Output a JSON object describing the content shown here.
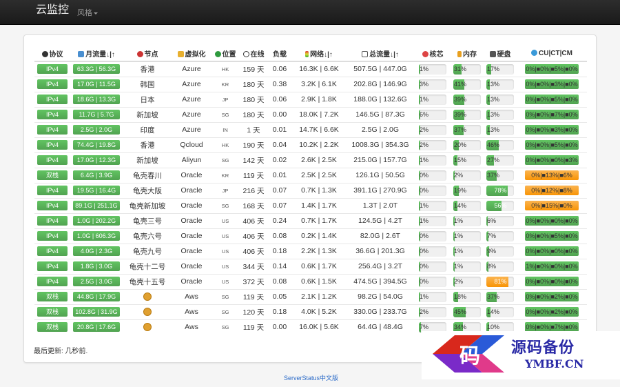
{
  "navbar": {
    "brand": "云监控",
    "style_menu": "风格"
  },
  "columns": {
    "protocol": "协议",
    "monthly_traffic": "月流量↓|↑",
    "node": "节点",
    "virtualization": "虚拟化",
    "location": "位置",
    "uptime": "在线",
    "load": "负载",
    "network": "网络↓|↑",
    "total_traffic": "总流量↓|↑",
    "cpu": "核芯",
    "memory": "内存",
    "disk": "硬盘",
    "cu_ct_cm": "CU|CT|CM"
  },
  "rows": [
    {
      "protocol": "IPv4",
      "monthly": "63.3G | 56.3G",
      "node": "香港",
      "node_lion": false,
      "virt": "Azure",
      "loc": "HK",
      "uptime": "159 天",
      "load": "0.06",
      "network": "16.3K | 6.6K",
      "total": "507.5G | 447.0G",
      "cpu": "1%",
      "cpu_level": 0.01,
      "mem": "31%",
      "mem_level": 0.31,
      "disk": "17%",
      "disk_level": 0.17,
      "disk_warn": false,
      "cuct": "0%|■0%|■5%|■0%",
      "cuct_warn": false
    },
    {
      "protocol": "IPv4",
      "monthly": "17.0G | 11.5G",
      "node": "韩国",
      "node_lion": false,
      "virt": "Azure",
      "loc": "KR",
      "uptime": "180 天",
      "load": "0.38",
      "network": "3.2K | 6.1K",
      "total": "202.8G | 146.9G",
      "cpu": "3%",
      "cpu_level": 0.03,
      "mem": "41%",
      "mem_level": 0.41,
      "disk": "13%",
      "disk_level": 0.13,
      "disk_warn": false,
      "cuct": "0%|■0%|■3%|■0%",
      "cuct_warn": false
    },
    {
      "protocol": "IPv4",
      "monthly": "18.6G | 13.3G",
      "node": "日本",
      "node_lion": false,
      "virt": "Azure",
      "loc": "JP",
      "uptime": "180 天",
      "load": "0.06",
      "network": "2.9K | 1.8K",
      "total": "188.0G | 132.6G",
      "cpu": "1%",
      "cpu_level": 0.01,
      "mem": "39%",
      "mem_level": 0.39,
      "disk": "13%",
      "disk_level": 0.13,
      "disk_warn": false,
      "cuct": "0%|■0%|■5%|■0%",
      "cuct_warn": false
    },
    {
      "protocol": "IPv4",
      "monthly": "11.7G | 5.7G",
      "node": "新加坡",
      "node_lion": false,
      "virt": "Azure",
      "loc": "SG",
      "uptime": "180 天",
      "load": "0.00",
      "network": "18.0K | 7.2K",
      "total": "146.5G | 87.3G",
      "cpu": "6%",
      "cpu_level": 0.06,
      "mem": "39%",
      "mem_level": 0.39,
      "disk": "13%",
      "disk_level": 0.13,
      "disk_warn": false,
      "cuct": "0%|■0%|■7%|■0%",
      "cuct_warn": false
    },
    {
      "protocol": "IPv4",
      "monthly": "2.5G | 2.0G",
      "node": "印度",
      "node_lion": false,
      "virt": "Azure",
      "loc": "IN",
      "uptime": "1 天",
      "load": "0.01",
      "network": "14.7K | 6.6K",
      "total": "2.5G | 2.0G",
      "cpu": "2%",
      "cpu_level": 0.02,
      "mem": "37%",
      "mem_level": 0.37,
      "disk": "13%",
      "disk_level": 0.13,
      "disk_warn": false,
      "cuct": "0%|■0%|■3%|■0%",
      "cuct_warn": false
    },
    {
      "protocol": "IPv4",
      "monthly": "74.4G | 19.8G",
      "node": "香港",
      "node_lion": false,
      "virt": "Qcloud",
      "loc": "HK",
      "uptime": "190 天",
      "load": "0.04",
      "network": "10.2K | 2.2K",
      "total": "1008.3G | 354.3G",
      "cpu": "2%",
      "cpu_level": 0.02,
      "mem": "20%",
      "mem_level": 0.2,
      "disk": "46%",
      "disk_level": 0.46,
      "disk_warn": false,
      "cuct": "0%|■0%|■5%|■0%",
      "cuct_warn": false
    },
    {
      "protocol": "IPv4",
      "monthly": "17.0G | 12.3G",
      "node": "新加坡",
      "node_lion": false,
      "virt": "Aliyun",
      "loc": "SG",
      "uptime": "142 天",
      "load": "0.02",
      "network": "2.6K | 2.5K",
      "total": "215.0G | 157.7G",
      "cpu": "1%",
      "cpu_level": 0.01,
      "mem": "15%",
      "mem_level": 0.15,
      "disk": "27%",
      "disk_level": 0.27,
      "disk_warn": false,
      "cuct": "0%|■0%|■0%|■3%",
      "cuct_warn": false
    },
    {
      "protocol": "双栈",
      "monthly": "6.4G | 3.9G",
      "node": "龟壳春川",
      "node_lion": false,
      "virt": "Oracle",
      "loc": "KR",
      "uptime": "119 天",
      "load": "0.01",
      "network": "2.5K | 2.5K",
      "total": "126.1G | 50.5G",
      "cpu": "0%",
      "cpu_level": 0,
      "mem": "2%",
      "mem_level": 0.02,
      "disk": "37%",
      "disk_level": 0.37,
      "disk_warn": false,
      "cuct": "0%|■13%|■6%",
      "cuct_warn": true
    },
    {
      "protocol": "IPv4",
      "monthly": "19.5G | 16.4G",
      "node": "龟壳大阪",
      "node_lion": false,
      "virt": "Oracle",
      "loc": "JP",
      "uptime": "216 天",
      "load": "0.07",
      "network": "0.7K | 1.3K",
      "total": "391.1G | 270.9G",
      "cpu": "0%",
      "cpu_level": 0,
      "mem": "19%",
      "mem_level": 0.19,
      "disk": "78%",
      "disk_level": 0.78,
      "disk_warn": false,
      "cuct": "0%|■12%|■8%",
      "cuct_warn": true
    },
    {
      "protocol": "IPv4",
      "monthly": "89.1G | 251.1G",
      "node": "龟壳新加坡",
      "node_lion": false,
      "virt": "Oracle",
      "loc": "SG",
      "uptime": "168 天",
      "load": "0.07",
      "network": "1.4K | 1.7K",
      "total": "1.3T | 2.0T",
      "cpu": "1%",
      "cpu_level": 0.01,
      "mem": "14%",
      "mem_level": 0.14,
      "disk": "56%",
      "disk_level": 0.56,
      "disk_warn": false,
      "cuct": "0%|■15%|■0%",
      "cuct_warn": true
    },
    {
      "protocol": "IPv4",
      "monthly": "1.0G | 202.2G",
      "node": "龟壳三号",
      "node_lion": false,
      "virt": "Oracle",
      "loc": "US",
      "uptime": "406 天",
      "load": "0.24",
      "network": "0.7K | 1.7K",
      "total": "124.5G | 4.2T",
      "cpu": "1%",
      "cpu_level": 0.01,
      "mem": "1%",
      "mem_level": 0.01,
      "disk": "6%",
      "disk_level": 0.06,
      "disk_warn": false,
      "cuct": "0%|■0%|■0%|■0%",
      "cuct_warn": false
    },
    {
      "protocol": "IPv4",
      "monthly": "1.0G | 606.3G",
      "node": "龟壳六号",
      "node_lion": false,
      "virt": "Oracle",
      "loc": "US",
      "uptime": "406 天",
      "load": "0.08",
      "network": "0.2K | 1.4K",
      "total": "82.0G | 2.6T",
      "cpu": "0%",
      "cpu_level": 0,
      "mem": "1%",
      "mem_level": 0.01,
      "disk": "7%",
      "disk_level": 0.07,
      "disk_warn": false,
      "cuct": "0%|■0%|■5%|■0%",
      "cuct_warn": false
    },
    {
      "protocol": "IPv4",
      "monthly": "4.0G | 2.3G",
      "node": "龟壳九号",
      "node_lion": false,
      "virt": "Oracle",
      "loc": "US",
      "uptime": "406 天",
      "load": "0.18",
      "network": "2.2K | 1.3K",
      "total": "36.6G | 201.3G",
      "cpu": "0%",
      "cpu_level": 0,
      "mem": "1%",
      "mem_level": 0.01,
      "disk": "9%",
      "disk_level": 0.09,
      "disk_warn": false,
      "cuct": "0%|■0%|■0%|■0%",
      "cuct_warn": false
    },
    {
      "protocol": "IPv4",
      "monthly": "1.8G | 3.0G",
      "node": "龟壳十二号",
      "node_lion": false,
      "virt": "Oracle",
      "loc": "US",
      "uptime": "344 天",
      "load": "0.14",
      "network": "0.6K | 1.7K",
      "total": "256.4G | 3.2T",
      "cpu": "0%",
      "cpu_level": 0,
      "mem": "1%",
      "mem_level": 0.01,
      "disk": "8%",
      "disk_level": 0.08,
      "disk_warn": false,
      "cuct": "1%|■0%|■0%|■0%",
      "cuct_warn": false
    },
    {
      "protocol": "IPv4",
      "monthly": "2.5G | 3.0G",
      "node": "龟壳十五号",
      "node_lion": false,
      "virt": "Oracle",
      "loc": "US",
      "uptime": "372 天",
      "load": "0.08",
      "network": "0.6K | 1.5K",
      "total": "474.5G | 394.5G",
      "cpu": "0%",
      "cpu_level": 0,
      "mem": "2%",
      "mem_level": 0.02,
      "disk": "81%",
      "disk_level": 0.81,
      "disk_warn": true,
      "cuct": "0%|■0%|■0%|■0%",
      "cuct_warn": false
    },
    {
      "protocol": "双栈",
      "monthly": "44.8G | 17.9G",
      "node": "",
      "node_lion": true,
      "virt": "Aws",
      "loc": "SG",
      "uptime": "119 天",
      "load": "0.05",
      "network": "2.1K | 1.2K",
      "total": "98.2G | 54.0G",
      "cpu": "1%",
      "cpu_level": 0.01,
      "mem": "18%",
      "mem_level": 0.18,
      "disk": "37%",
      "disk_level": 0.37,
      "disk_warn": false,
      "cuct": "0%|■0%|■2%|■0%",
      "cuct_warn": false
    },
    {
      "protocol": "双栈",
      "monthly": "102.8G | 31.9G",
      "node": "",
      "node_lion": true,
      "virt": "Aws",
      "loc": "SG",
      "uptime": "120 天",
      "load": "0.18",
      "network": "4.0K | 5.2K",
      "total": "330.0G | 233.7G",
      "cpu": "2%",
      "cpu_level": 0.02,
      "mem": "45%",
      "mem_level": 0.45,
      "disk": "14%",
      "disk_level": 0.14,
      "disk_warn": false,
      "cuct": "0%|■0%|■2%|■0%",
      "cuct_warn": false
    },
    {
      "protocol": "双栈",
      "monthly": "20.8G | 17.6G",
      "node": "",
      "node_lion": true,
      "virt": "Aws",
      "loc": "SG",
      "uptime": "119 天",
      "load": "0.00",
      "network": "16.0K | 5.6K",
      "total": "64.4G | 48.4G",
      "cpu": "7%",
      "cpu_level": 0.07,
      "mem": "34%",
      "mem_level": 0.34,
      "disk": "10%",
      "disk_level": 0.1,
      "disk_warn": false,
      "cuct": "0%|■0%|■7%|■0%",
      "cuct_warn": false
    }
  ],
  "last_updated": "最后更新: 几秒前.",
  "footer": "ServerStatus中文版",
  "watermark": {
    "title": "源码备份",
    "subtitle": "YMBF.CN",
    "logo_char": "码"
  },
  "colors": {
    "bar_green": "#51a351",
    "bar_orange": "#f89406",
    "navbar": "#222222",
    "link": "#2a6ac8"
  }
}
